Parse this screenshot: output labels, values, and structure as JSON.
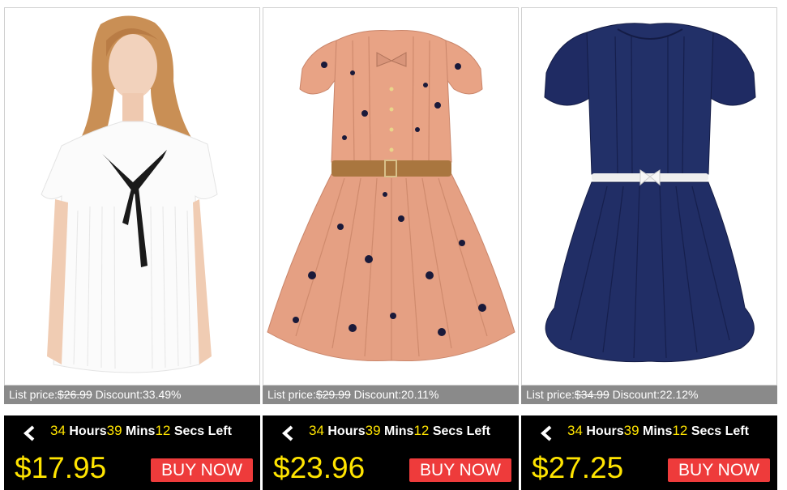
{
  "products": [
    {
      "id_label": "product-1",
      "image_icon": "white-pleated-blouse-image",
      "list_price_label": "List price:",
      "list_price": "$26.99",
      "discount_label": "Discount:",
      "discount": "33.49%",
      "hours": "34",
      "hours_label": "Hours",
      "mins": "39",
      "mins_label": "Mins",
      "secs": "12",
      "secs_label": "Secs Left",
      "price": "$17.95",
      "buy_label": "BUY NOW"
    },
    {
      "id_label": "product-2",
      "image_icon": "pink-polka-dot-dress-image",
      "list_price_label": "List price:",
      "list_price": "$29.99",
      "discount_label": "Discount:",
      "discount": "20.11%",
      "hours": "34",
      "hours_label": "Hours",
      "mins": "39",
      "mins_label": "Mins",
      "secs": "12",
      "secs_label": "Secs Left",
      "price": "$23.96",
      "buy_label": "BUY NOW"
    },
    {
      "id_label": "product-3",
      "image_icon": "navy-pleated-dress-image",
      "list_price_label": "List price:",
      "list_price": "$34.99",
      "discount_label": "Discount:",
      "discount": "22.12%",
      "hours": "34",
      "hours_label": "Hours",
      "mins": "39",
      "mins_label": "Mins",
      "secs": "12",
      "secs_label": "Secs Left",
      "price": "$27.25",
      "buy_label": "BUY NOW"
    }
  ],
  "colors": {
    "price_yellow": "#ffe400",
    "buy_red": "#ee3b3b",
    "bar_gray": "#8a8a8a",
    "bar_black": "#000000"
  }
}
